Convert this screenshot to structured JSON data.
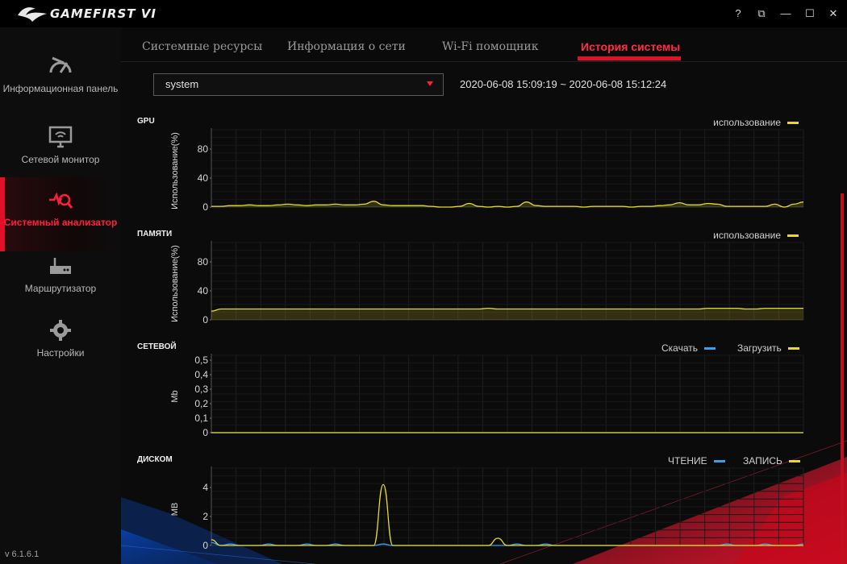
{
  "app": {
    "title": "GAMEFIRST VI"
  },
  "window": {
    "help": "?",
    "restore_alt": "⧉",
    "minimize": "—",
    "maximize": "☐",
    "close": "✕"
  },
  "sidebar": {
    "items": [
      {
        "label": "Информационная панель",
        "icon": "dashboard-icon"
      },
      {
        "label": "Сетевой монитор",
        "icon": "monitor-icon"
      },
      {
        "label": "Системный анализатор",
        "icon": "analyzer-icon",
        "active": true
      },
      {
        "label": "Маршрутизатор",
        "icon": "router-icon"
      },
      {
        "label": "Настройки",
        "icon": "gear-icon"
      }
    ],
    "version": "v 6.1.6.1"
  },
  "tabs": [
    {
      "label": "Системные ресурсы"
    },
    {
      "label": "Информация о сети"
    },
    {
      "label": "Wi-Fi помощник"
    },
    {
      "label": "История системы",
      "active": true
    }
  ],
  "filter": {
    "selected": "system"
  },
  "time_range": "2020-06-08 15:09:19 ~ 2020-06-08 15:12:24",
  "colors": {
    "accent": "#e0102a",
    "yellow": "#e6d92a",
    "blue": "#3a9ee8"
  },
  "chart_data": [
    {
      "type": "area",
      "title": "GPU",
      "ylabel": "Использование(%)",
      "ylim": [
        0,
        100
      ],
      "yticks": [
        "0",
        "40",
        "80"
      ],
      "series": [
        {
          "name": "использование",
          "color": "#e6d92a",
          "values": [
            1,
            1,
            2,
            2,
            3,
            2,
            2,
            3,
            4,
            3,
            2,
            3,
            3,
            4,
            3,
            3,
            4,
            8,
            3,
            2,
            2,
            2,
            2,
            1,
            0,
            0,
            1,
            5,
            1,
            0,
            1,
            0,
            1,
            7,
            2,
            1,
            1,
            1,
            1,
            0,
            1,
            1,
            1,
            1,
            0,
            1,
            1,
            2,
            3,
            6,
            3,
            3,
            5,
            4,
            1,
            1,
            1,
            1,
            1,
            4,
            0,
            4,
            7
          ]
        }
      ]
    },
    {
      "type": "area",
      "title": "ПАМЯТИ",
      "ylabel": "Использование(%)",
      "ylim": [
        0,
        100
      ],
      "yticks": [
        "0",
        "40",
        "80"
      ],
      "series": [
        {
          "name": "использование",
          "color": "#e6d92a",
          "values": [
            12,
            15,
            15,
            15,
            15,
            15,
            15,
            15,
            15,
            15,
            15,
            15,
            15,
            15,
            15,
            15,
            15,
            15,
            15,
            15,
            15,
            15,
            15,
            15,
            15,
            15,
            15,
            15,
            15,
            16,
            15,
            15,
            15,
            15,
            15,
            15,
            15,
            15,
            15,
            15,
            15,
            15,
            15,
            15,
            15,
            15,
            15,
            15,
            15,
            15,
            15,
            15,
            16,
            16,
            16,
            16,
            15,
            15,
            16,
            16,
            16,
            16,
            16
          ]
        }
      ]
    },
    {
      "type": "line",
      "title": "СЕТЕВОЙ",
      "ylabel": "Mb",
      "ylim": [
        0,
        0.5
      ],
      "yticks": [
        "0",
        "0,1",
        "0,2",
        "0,3",
        "0,4",
        "0,5"
      ],
      "series": [
        {
          "name": "Скачать",
          "color": "#3a9ee8",
          "values": [
            0,
            0,
            0,
            0,
            0,
            0,
            0,
            0,
            0,
            0,
            0,
            0,
            0,
            0,
            0,
            0,
            0,
            0,
            0,
            0,
            0,
            0,
            0,
            0,
            0,
            0,
            0,
            0,
            0,
            0,
            0,
            0,
            0,
            0,
            0,
            0,
            0,
            0,
            0,
            0,
            0,
            0,
            0,
            0,
            0,
            0,
            0,
            0,
            0,
            0,
            0,
            0,
            0,
            0,
            0,
            0,
            0,
            0,
            0,
            0,
            0,
            0,
            0
          ]
        },
        {
          "name": "Загрузить",
          "color": "#e6d92a",
          "values": [
            0,
            0,
            0,
            0,
            0,
            0,
            0,
            0,
            0,
            0,
            0,
            0,
            0,
            0,
            0,
            0,
            0,
            0,
            0,
            0,
            0,
            0,
            0,
            0,
            0,
            0,
            0,
            0,
            0,
            0,
            0,
            0,
            0,
            0,
            0,
            0,
            0,
            0,
            0,
            0,
            0,
            0,
            0,
            0,
            0,
            0,
            0,
            0,
            0,
            0,
            0,
            0,
            0,
            0,
            0,
            0,
            0,
            0,
            0,
            0,
            0,
            0,
            0
          ]
        }
      ]
    },
    {
      "type": "line",
      "title": "ДИСКОМ",
      "ylabel": "MB",
      "ylim": [
        0,
        5
      ],
      "yticks": [
        "0",
        "2",
        "4"
      ],
      "series": [
        {
          "name": "ЧТЕНИЕ",
          "color": "#3a9ee8",
          "values": [
            0.2,
            0,
            0.1,
            0,
            0,
            0,
            0.1,
            0,
            0,
            0,
            0.1,
            0,
            0,
            0.1,
            0,
            0,
            0,
            0,
            0.1,
            0,
            0,
            0,
            0,
            0,
            0,
            0,
            0,
            0,
            0,
            0,
            0,
            0,
            0.1,
            0,
            0,
            0.1,
            0,
            0,
            0,
            0,
            0,
            0,
            0,
            0,
            0,
            0,
            0,
            0,
            0,
            0,
            0,
            0,
            0,
            0,
            0.1,
            0,
            0,
            0,
            0.1,
            0,
            0,
            0,
            0.1
          ]
        },
        {
          "name": "ЗАПИСЬ",
          "color": "#e6d92a",
          "values": [
            0.4,
            0,
            0,
            0,
            0,
            0,
            0,
            0,
            0,
            0,
            0,
            0,
            0,
            0,
            0,
            0,
            0,
            0,
            4.2,
            0,
            0,
            0,
            0,
            0,
            0,
            0,
            0,
            0,
            0,
            0,
            0.5,
            0,
            0,
            0,
            0,
            0,
            0,
            0,
            0,
            0,
            0,
            0,
            0,
            0,
            0,
            0,
            0,
            0,
            0,
            0,
            0,
            0,
            0,
            0,
            0,
            0,
            0,
            0,
            0,
            0,
            0,
            0,
            0
          ]
        }
      ]
    }
  ]
}
